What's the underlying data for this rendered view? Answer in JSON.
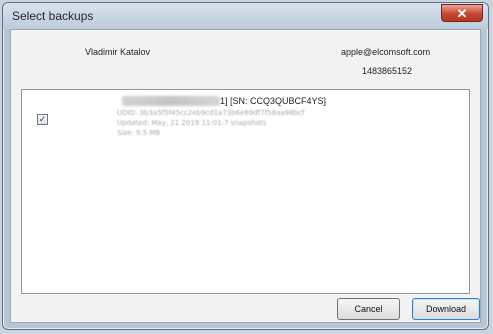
{
  "window": {
    "title": "Select backups",
    "close_glyph": "✕"
  },
  "account": {
    "user_name": "Vladimir Katalov",
    "email": "apple@elcomsoft.com",
    "id": "1483865152"
  },
  "backups": [
    {
      "checked": true,
      "check_glyph": "✓",
      "title_suffix": "1] [SN: CCQ3QUBCF4YS]",
      "udid": "UDID: 3b3a5f5f45cc2eb9cd1a73b6e69df7f58aa98bcf",
      "updated": "Updated: May, 21 2019 11:01:7 snapshots",
      "size": "Size: 9.5 MB"
    }
  ],
  "buttons": {
    "cancel": "Cancel",
    "download": "Download"
  },
  "colors": {
    "title_bar": "#bccbdb",
    "close_button": "#c7452f",
    "list_background": "#ffffff"
  },
  "icons": {
    "close": "close-icon",
    "checkbox": "checkbox-checked-icon"
  }
}
